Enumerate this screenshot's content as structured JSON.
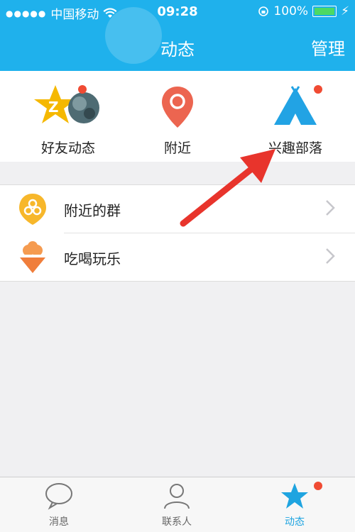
{
  "status": {
    "carrier": "中国移动",
    "time": "09:28",
    "battery": "100%"
  },
  "header": {
    "title": "动态",
    "manage": "管理"
  },
  "quick": [
    {
      "label": "好友动态",
      "icon": "friend-feed-icon"
    },
    {
      "label": "附近",
      "icon": "nearby-pin-icon"
    },
    {
      "label": "兴趣部落",
      "icon": "tribe-tent-icon"
    }
  ],
  "list": [
    {
      "label": "附近的群",
      "icon": "nearby-groups-icon"
    },
    {
      "label": "吃喝玩乐",
      "icon": "food-fun-icon"
    }
  ],
  "tabs": [
    {
      "label": "消息",
      "icon": "chat-bubble-icon"
    },
    {
      "label": "联系人",
      "icon": "contacts-icon"
    },
    {
      "label": "动态",
      "icon": "star-feed-icon"
    }
  ],
  "colors": {
    "accent": "#1fb1ec",
    "badge": "#f04b33",
    "arrow": "#e8342c"
  }
}
